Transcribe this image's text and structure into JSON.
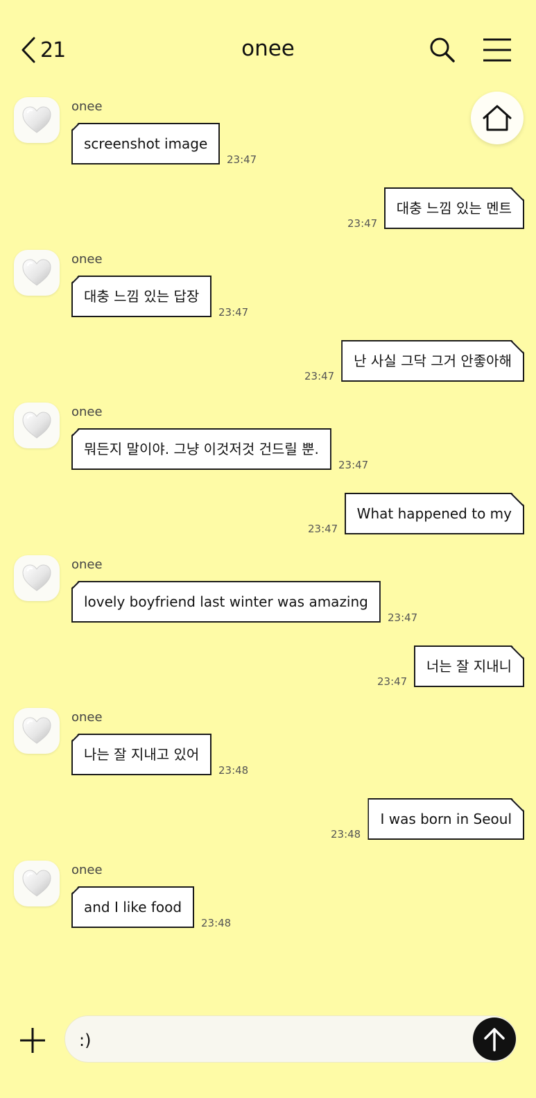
{
  "header": {
    "back_count": "21",
    "title": "onee"
  },
  "messages": [
    {
      "dir": "in",
      "sender": "onee",
      "text": "screenshot image",
      "time": "23:47"
    },
    {
      "dir": "out",
      "text": "대충 느낌 있는 멘트",
      "time": "23:47"
    },
    {
      "dir": "in",
      "sender": "onee",
      "text": "대충 느낌 있는 답장",
      "time": "23:47"
    },
    {
      "dir": "out",
      "text": "난 사실 그닥 그거 안좋아해",
      "time": "23:47"
    },
    {
      "dir": "in",
      "sender": "onee",
      "text": "뭐든지 말이야. 그냥 이것저것 건드릴 뿐.",
      "time": "23:47"
    },
    {
      "dir": "out",
      "text": "What happened to my",
      "time": "23:47"
    },
    {
      "dir": "in",
      "sender": "onee",
      "text": "lovely boyfriend last winter was amazing",
      "time": "23:47"
    },
    {
      "dir": "out",
      "text": "너는 잘 지내니",
      "time": "23:47"
    },
    {
      "dir": "in",
      "sender": "onee",
      "text": "나는 잘 지내고 있어",
      "time": "23:48"
    },
    {
      "dir": "out",
      "text": "I was born in Seoul",
      "time": "23:48"
    },
    {
      "dir": "in",
      "sender": "onee",
      "text": "and I like food",
      "time": "23:48"
    }
  ],
  "input": {
    "value": ":)"
  },
  "icons": {
    "back": "chevron-left-icon",
    "search": "search-icon",
    "menu": "hamburger-menu-icon",
    "home": "home-icon",
    "avatar": "heart-icon",
    "add": "plus-icon",
    "send": "arrow-up-icon"
  },
  "colors": {
    "background": "#fefba6",
    "bubble": "#ffffff",
    "bubble_border": "#1a1a1a",
    "send_button": "#111111"
  }
}
